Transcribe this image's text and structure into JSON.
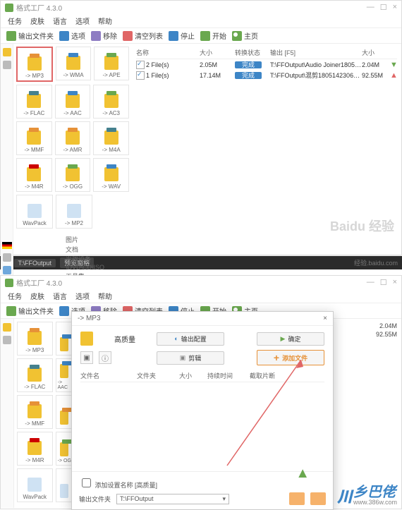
{
  "app": {
    "title": "格式工厂 4.3.0",
    "menus": [
      "任务",
      "皮肤",
      "语言",
      "选项",
      "帮助"
    ],
    "toolbar": {
      "output": "输出文件夹",
      "settings": "选项",
      "selectall": "移除",
      "remove": "清空列表",
      "play": "停止",
      "start": "开始",
      "home": "主页"
    }
  },
  "formats": [
    [
      "-> MP3",
      "-> WMA",
      "-> APE"
    ],
    [
      "-> FLAC",
      "-> AAC",
      "-> AC3"
    ],
    [
      "-> MMF",
      "-> AMR",
      "-> M4A"
    ],
    [
      "-> M4R",
      "-> OGG",
      "-> WAV"
    ],
    [
      "WavPack",
      "-> MP2",
      ""
    ]
  ],
  "file_headers": {
    "name": "名称",
    "size": "大小",
    "status": "转换状态",
    "output": "输出 [F5]",
    "outsize": "大小"
  },
  "files": [
    {
      "name": "2 File(s)",
      "size": "2.05M",
      "status": "完成",
      "out": "T:\\FFOutput\\Audio Joiner180514...",
      "outsize": "2.04M",
      "dir": "down"
    },
    {
      "name": "1 File(s)",
      "size": "17.14M",
      "status": "完成",
      "out": "T:\\FFOutput\\混剪180514230650...",
      "outsize": "92.55M",
      "dir": "up"
    }
  ],
  "info": {
    "l1": "图片",
    "l2": "文档",
    "l3": "光驱设备\\DVD\\CD\\ISO",
    "l4": "工具集"
  },
  "watermark": "Baidu 经验",
  "taskbar": {
    "item": "T:\\FFOutput",
    "item2": "预览窗格",
    "right": "经验.baidu.com"
  },
  "dialog": {
    "title": "-> MP3",
    "quality": "高质量",
    "btn_config": "输出配置",
    "btn_convert": "确定",
    "btn_clip": "剪辑",
    "btn_add": "添加文件",
    "cols": {
      "name": "文件名",
      "folder": "文件夹",
      "size": "大小",
      "duration": "持续时间",
      "clip": "截取片断"
    },
    "foot_check": "添加设置名称 [高质量]",
    "foot_label": "输出文件夹",
    "foot_path": "T:\\FFOutput"
  },
  "files2": [
    {
      "outsize": "2.04M"
    },
    {
      "outsize": "92.55M"
    }
  ],
  "wm2": {
    "brand": "乡巴佬",
    "url": "www.386w.com"
  }
}
